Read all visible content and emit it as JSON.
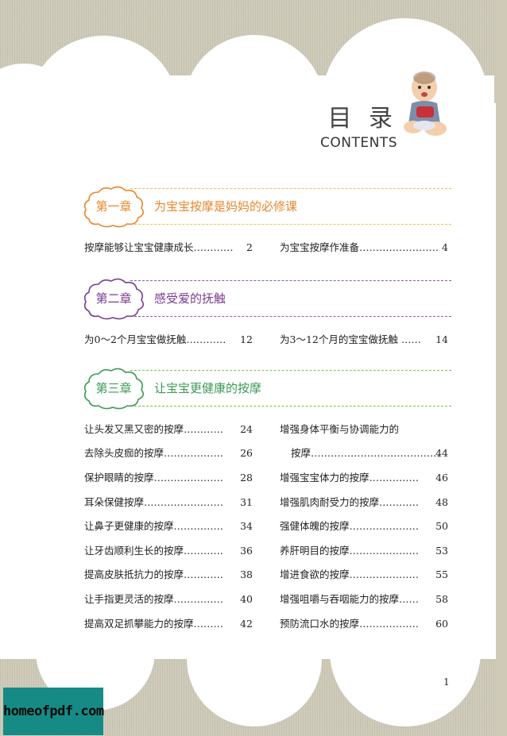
{
  "heading": {
    "title_zh": "目 录",
    "title_en": "CONTENTS"
  },
  "chapters": [
    {
      "badge": "第一章",
      "title": "为宝宝按摩是妈妈的必修课",
      "color": "#e9862a",
      "line_color": "#f0c04a",
      "entries": [
        {
          "label": "按摩能够让宝宝健康成长…………",
          "page": "2"
        },
        {
          "label": "为宝宝按摩作准备……………………",
          "page": "4"
        }
      ]
    },
    {
      "badge": "第二章",
      "title": "感受爱的抚触",
      "color": "#7a3d8e",
      "line_color": "#8a5aa8",
      "entries": [
        {
          "label": "为0～2个月宝宝做抚触…………",
          "page": "12"
        },
        {
          "label": "为3～12个月的宝宝做抚触 ……",
          "page": "14"
        }
      ]
    },
    {
      "badge": "第三章",
      "title": "让宝宝更健康的按摩",
      "color": "#3c9a55",
      "line_color": "#7cc04a",
      "entries_left": [
        {
          "label": "让头发又黑又密的按摩…………",
          "page": "24"
        },
        {
          "label": "去除头皮痂的按摩………………",
          "page": "26"
        },
        {
          "label": "保护眼睛的按摩…………………",
          "page": "28"
        },
        {
          "label": "耳朵保健按摩……………………",
          "page": "31"
        },
        {
          "label": "让鼻子更健康的按摩……………",
          "page": "34"
        },
        {
          "label": "让牙齿顺利生长的按摩…………",
          "page": "36"
        },
        {
          "label": "提高皮肤抵抗力的按摩…………",
          "page": "38"
        },
        {
          "label": "让手指更灵活的按摩……………",
          "page": "40"
        },
        {
          "label": "提高双足抓攀能力的按摩………",
          "page": "42"
        }
      ],
      "entries_right": [
        {
          "label": "增强身体平衡与协调能力的",
          "page": ""
        },
        {
          "label": "按摩…………………………………",
          "page": "44"
        },
        {
          "label": "增强宝宝体力的按摩……………",
          "page": "46"
        },
        {
          "label": "增强肌肉耐受力的按摩…………",
          "page": "48"
        },
        {
          "label": "强健体魄的按摩…………………",
          "page": "50"
        },
        {
          "label": "养肝明目的按摩…………………",
          "page": "53"
        },
        {
          "label": "增进食欲的按摩…………………",
          "page": "55"
        },
        {
          "label": "增强咀嚼与吞咽能力的按摩……",
          "page": "58"
        },
        {
          "label": "预防流口水的按摩………………",
          "page": "60"
        }
      ]
    }
  ],
  "page_number": "1",
  "watermark": "homeofpdf.com",
  "icons": {
    "baby": "baby-photo",
    "badge": "cloud-badge-icon"
  }
}
